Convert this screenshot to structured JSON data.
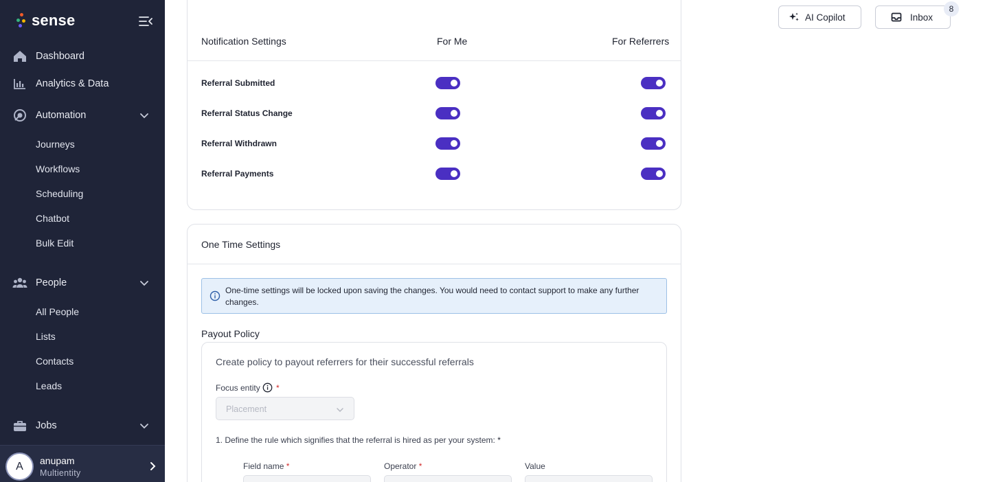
{
  "app": {
    "logo_text": "sense"
  },
  "sidebar": {
    "dashboard": "Dashboard",
    "analytics": "Analytics & Data",
    "automation": {
      "label": "Automation",
      "items": [
        "Journeys",
        "Workflows",
        "Scheduling",
        "Chatbot",
        "Bulk Edit"
      ]
    },
    "people": {
      "label": "People",
      "items": [
        "All People",
        "Lists",
        "Contacts",
        "Leads"
      ]
    },
    "jobs": "Jobs",
    "user": {
      "initial": "A",
      "name": "anupam",
      "role": "Multientity"
    }
  },
  "topbar": {
    "copilot_label": "AI Copilot",
    "inbox_label": "Inbox",
    "inbox_count": "8"
  },
  "notification_settings": {
    "title": "Notification Settings",
    "col_me": "For Me",
    "col_referrers": "For Referrers",
    "rows": [
      {
        "label": "Referral Submitted",
        "for_me": true,
        "for_referrers": true
      },
      {
        "label": "Referral Status Change",
        "for_me": true,
        "for_referrers": true
      },
      {
        "label": "Referral Withdrawn",
        "for_me": true,
        "for_referrers": true
      },
      {
        "label": "Referral Payments",
        "for_me": true,
        "for_referrers": true
      }
    ]
  },
  "one_time_settings": {
    "title": "One Time Settings",
    "info": "One-time settings will be locked upon saving the changes. You would need to contact support to make any further changes.",
    "payout_policy": {
      "title": "Payout Policy",
      "subtitle": "Create policy to payout referrers for their successful referrals",
      "focus_entity_label": "Focus entity",
      "focus_entity_placeholder": "Placement",
      "rule_text": "1. Define the rule which signifies that the referral is hired as per your system:",
      "field_name_label": "Field name",
      "operator_label": "Operator",
      "value_label": "Value",
      "required_mark": "*"
    }
  },
  "colors": {
    "sidebar": "#1f2438",
    "toggle_on": "#4a2fc2",
    "info_bg": "#e6f0fb"
  }
}
